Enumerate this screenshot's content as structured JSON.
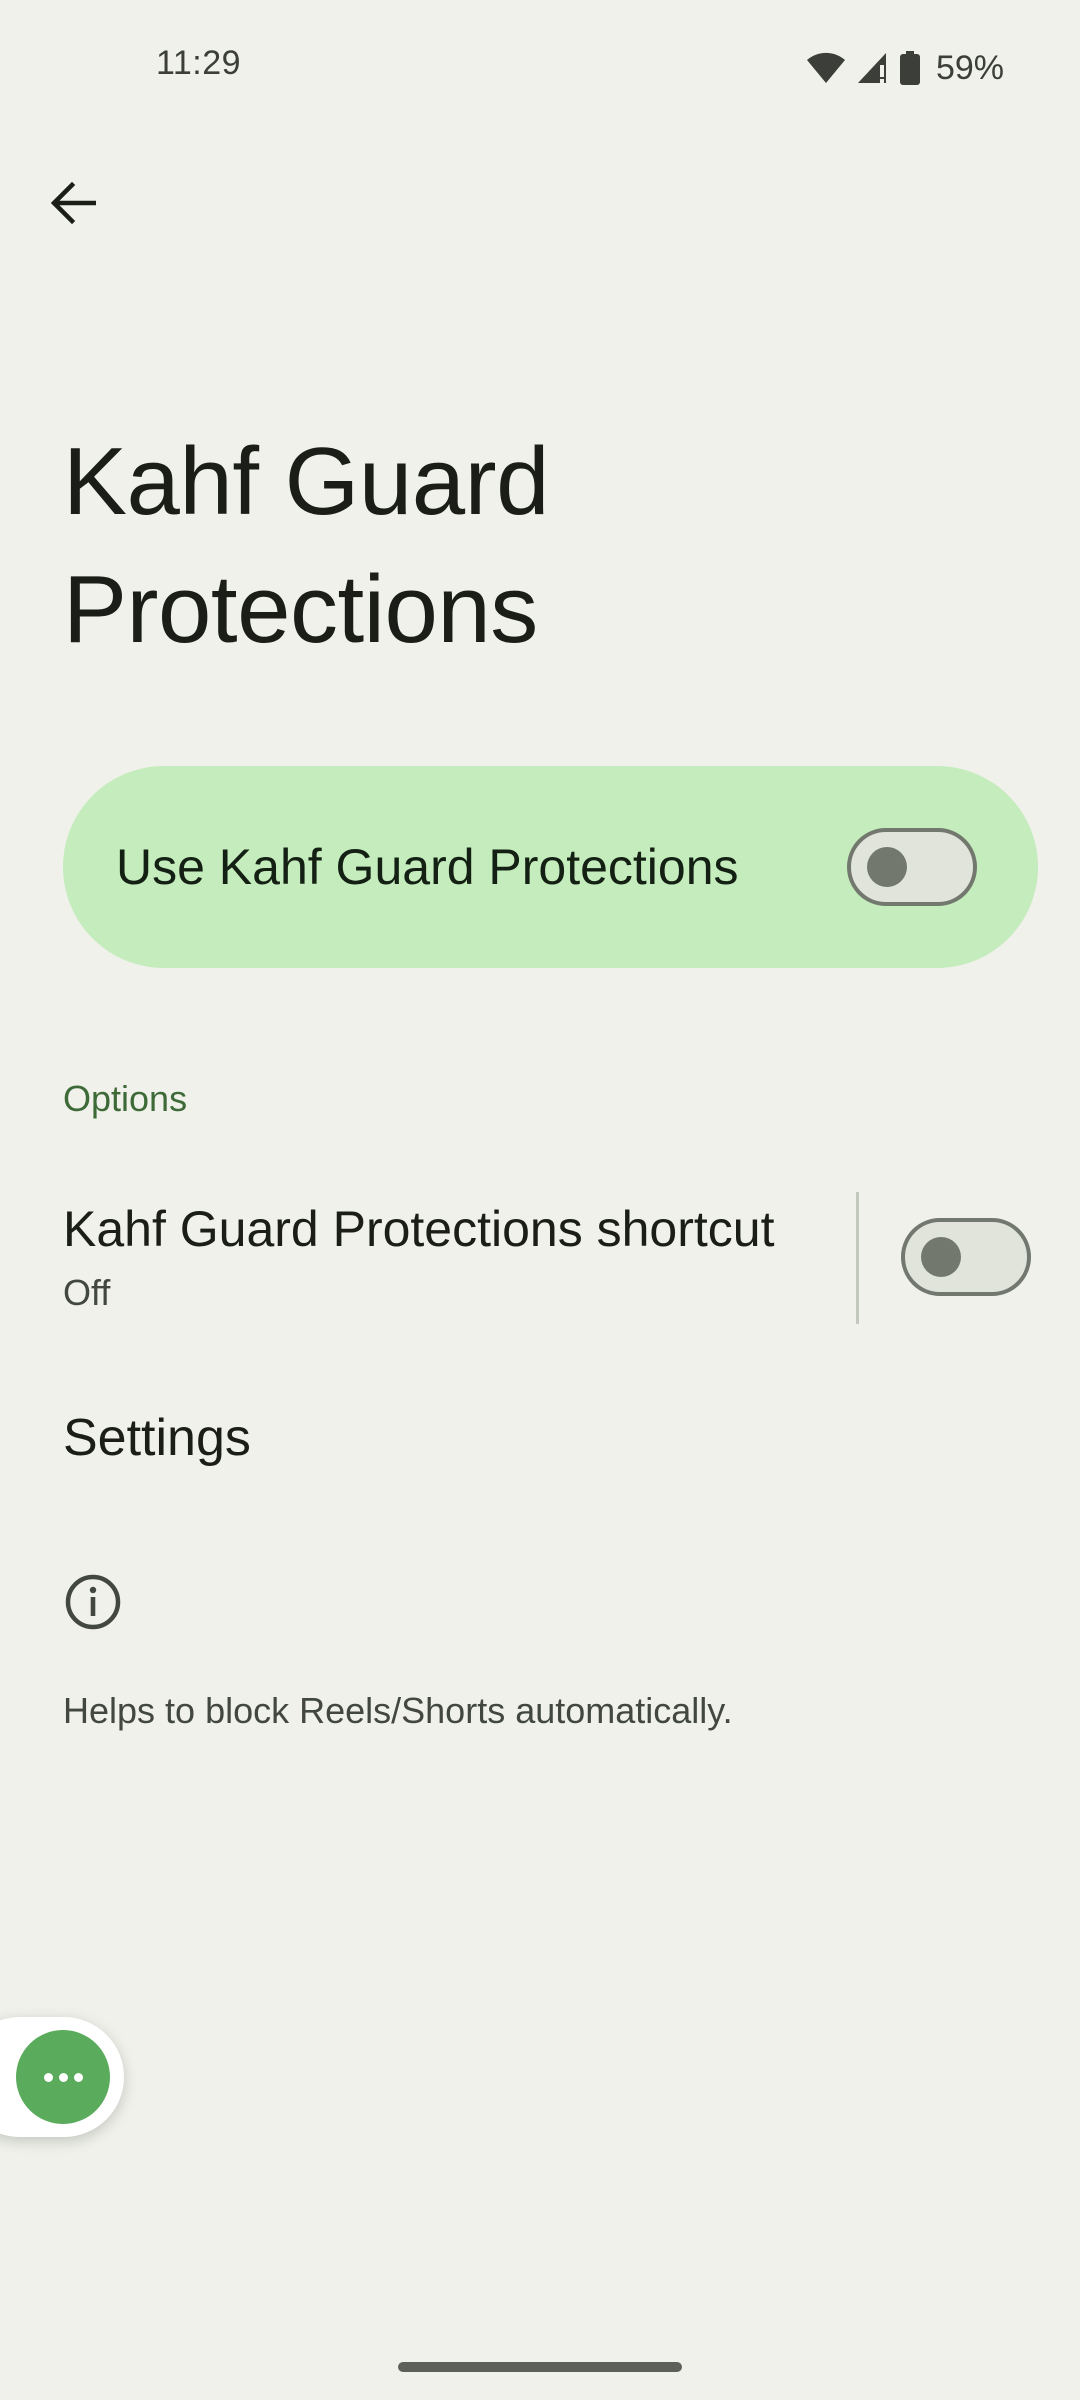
{
  "status_bar": {
    "time": "11:29",
    "battery_percent": "59%",
    "icons": [
      "wifi-icon",
      "cell-signal-icon",
      "battery-icon"
    ]
  },
  "header": {
    "back_icon": "arrow-back-icon"
  },
  "page": {
    "title": "Kahf Guard Protections"
  },
  "main_switch": {
    "label": "Use Kahf Guard Protections",
    "checked": false
  },
  "options": {
    "header": "Options",
    "shortcut": {
      "title": "Kahf Guard Protections shortcut",
      "summary": "Off",
      "checked": false
    },
    "settings_label": "Settings"
  },
  "footer": {
    "icon": "info-icon",
    "text": "Helps to block Reels/Shorts automatically."
  },
  "floating_button": {
    "icon": "more-horiz-icon"
  },
  "colors": {
    "background": "#eff1ea",
    "main_bar": "#c4ecbc",
    "accent_text": "#3e6a38",
    "floating_button": "#5aab5c",
    "switch_outline": "#72786e"
  }
}
